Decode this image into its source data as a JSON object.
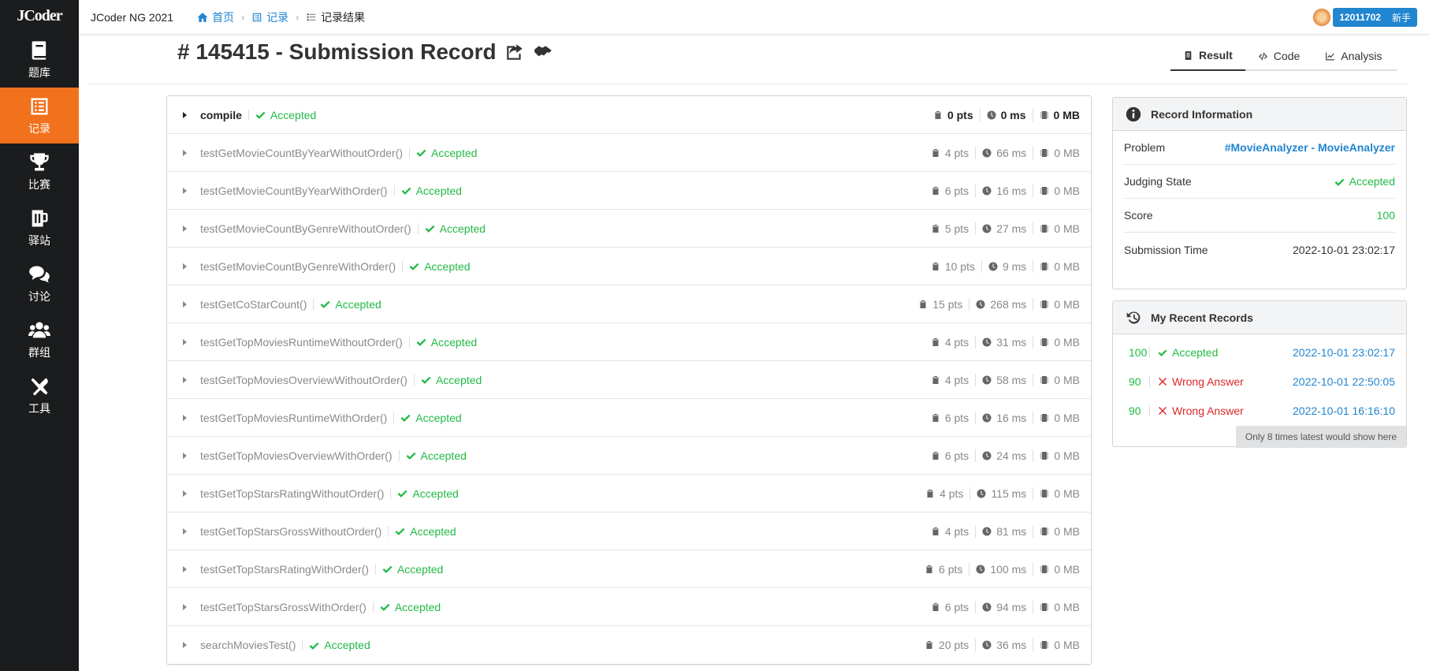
{
  "logo": "JCoder",
  "sidebar": {
    "items": [
      {
        "label": "题库",
        "icon": "book-icon"
      },
      {
        "label": "记录",
        "icon": "list-icon",
        "active": true
      },
      {
        "label": "比赛",
        "icon": "trophy-icon"
      },
      {
        "label": "驿站",
        "icon": "beer-icon"
      },
      {
        "label": "讨论",
        "icon": "comments-icon"
      },
      {
        "label": "群组",
        "icon": "users-icon"
      },
      {
        "label": "工具",
        "icon": "tools-icon"
      }
    ]
  },
  "topbar": {
    "site_title": "JCoder NG 2021",
    "breadcrumb": [
      {
        "label": "首页",
        "icon": "home-icon"
      },
      {
        "label": "记录",
        "icon": "list-icon"
      },
      {
        "label": "记录结果",
        "icon": "tasks-icon"
      }
    ],
    "user": {
      "id": "12011702",
      "rank": "新手"
    }
  },
  "header": {
    "title": "# 145415 - Submission Record",
    "tabs": [
      {
        "label": "Result",
        "icon": "file-icon",
        "active": true
      },
      {
        "label": "Code",
        "icon": "code-icon"
      },
      {
        "label": "Analysis",
        "icon": "chart-icon"
      }
    ]
  },
  "tests": [
    {
      "name": "compile",
      "verdict": "Accepted",
      "score": "0 pts",
      "time": "0 ms",
      "memory": "0 MB"
    },
    {
      "name": "testGetMovieCountByYearWithoutOrder()",
      "verdict": "Accepted",
      "score": "4 pts",
      "time": "66 ms",
      "memory": "0 MB"
    },
    {
      "name": "testGetMovieCountByYearWithOrder()",
      "verdict": "Accepted",
      "score": "6 pts",
      "time": "16 ms",
      "memory": "0 MB"
    },
    {
      "name": "testGetMovieCountByGenreWithoutOrder()",
      "verdict": "Accepted",
      "score": "5 pts",
      "time": "27 ms",
      "memory": "0 MB"
    },
    {
      "name": "testGetMovieCountByGenreWithOrder()",
      "verdict": "Accepted",
      "score": "10 pts",
      "time": "9 ms",
      "memory": "0 MB"
    },
    {
      "name": "testGetCoStarCount()",
      "verdict": "Accepted",
      "score": "15 pts",
      "time": "268 ms",
      "memory": "0 MB"
    },
    {
      "name": "testGetTopMoviesRuntimeWithoutOrder()",
      "verdict": "Accepted",
      "score": "4 pts",
      "time": "31 ms",
      "memory": "0 MB"
    },
    {
      "name": "testGetTopMoviesOverviewWithoutOrder()",
      "verdict": "Accepted",
      "score": "4 pts",
      "time": "58 ms",
      "memory": "0 MB"
    },
    {
      "name": "testGetTopMoviesRuntimeWithOrder()",
      "verdict": "Accepted",
      "score": "6 pts",
      "time": "16 ms",
      "memory": "0 MB"
    },
    {
      "name": "testGetTopMoviesOverviewWithOrder()",
      "verdict": "Accepted",
      "score": "6 pts",
      "time": "24 ms",
      "memory": "0 MB"
    },
    {
      "name": "testGetTopStarsRatingWithoutOrder()",
      "verdict": "Accepted",
      "score": "4 pts",
      "time": "115 ms",
      "memory": "0 MB"
    },
    {
      "name": "testGetTopStarsGrossWithoutOrder()",
      "verdict": "Accepted",
      "score": "4 pts",
      "time": "81 ms",
      "memory": "0 MB"
    },
    {
      "name": "testGetTopStarsRatingWithOrder()",
      "verdict": "Accepted",
      "score": "6 pts",
      "time": "100 ms",
      "memory": "0 MB"
    },
    {
      "name": "testGetTopStarsGrossWithOrder()",
      "verdict": "Accepted",
      "score": "6 pts",
      "time": "94 ms",
      "memory": "0 MB"
    },
    {
      "name": "searchMoviesTest()",
      "verdict": "Accepted",
      "score": "20 pts",
      "time": "36 ms",
      "memory": "0 MB"
    }
  ],
  "record_info": {
    "title": "Record Information",
    "rows": [
      {
        "label": "Problem",
        "value": "#MovieAnalyzer - MovieAnalyzer",
        "style": "link"
      },
      {
        "label": "Judging State",
        "value": "Accepted",
        "style": "green-check"
      },
      {
        "label": "Score",
        "value": "100",
        "style": "green"
      },
      {
        "label": "Submission Time",
        "value": "2022-10-01 23:02:17",
        "style": "dark"
      }
    ]
  },
  "recent_records": {
    "title": "My Recent Records",
    "items": [
      {
        "score": "100",
        "verdict": "Accepted",
        "ok": true,
        "time": "2022-10-01 23:02:17"
      },
      {
        "score": "90",
        "verdict": "Wrong Answer",
        "ok": false,
        "time": "2022-10-01 22:50:05"
      },
      {
        "score": "90",
        "verdict": "Wrong Answer",
        "ok": false,
        "time": "2022-10-01 16:16:10"
      }
    ],
    "note": "Only 8 times latest would show here"
  },
  "colors": {
    "accent": "#f2711c",
    "link": "#2185d0",
    "success": "#21ba45",
    "error": "#db2828",
    "sidebar": "#1b1c1d"
  }
}
